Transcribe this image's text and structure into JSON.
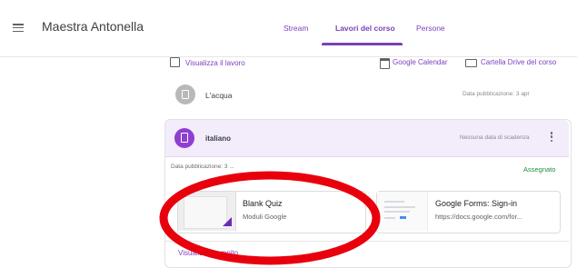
{
  "header": {
    "app_title": "Maestra Antonella",
    "menu_icon": "menu-icon",
    "tabs": [
      {
        "label": "Stream",
        "active": false
      },
      {
        "label": "Lavori del corso",
        "active": true
      },
      {
        "label": "Persone",
        "active": false
      }
    ]
  },
  "actions": {
    "view_work": "Visualizza il lavoro",
    "calendar": "Google Calendar",
    "drive_folder": "Cartella Drive del corso"
  },
  "topics": [
    {
      "title": "L'acqua",
      "date": "Data pubblicazione: 3 apr"
    }
  ],
  "assignment": {
    "title": "italiano",
    "due": "Nessuna data di scadenza",
    "published": "Data pubblicazione: 3 ...",
    "status": "Assegnato",
    "attachments": [
      {
        "title": "Blank Quiz",
        "subtitle": "Moduli Google"
      },
      {
        "title": "Google Forms: Sign-in",
        "subtitle": "https://docs.google.com/for..."
      }
    ],
    "view_assignment": "Visualizza compito"
  },
  "colors": {
    "accent": "#7b3fbd",
    "assigned_status": "#1e8e3e",
    "annotation": "#e8000d"
  }
}
